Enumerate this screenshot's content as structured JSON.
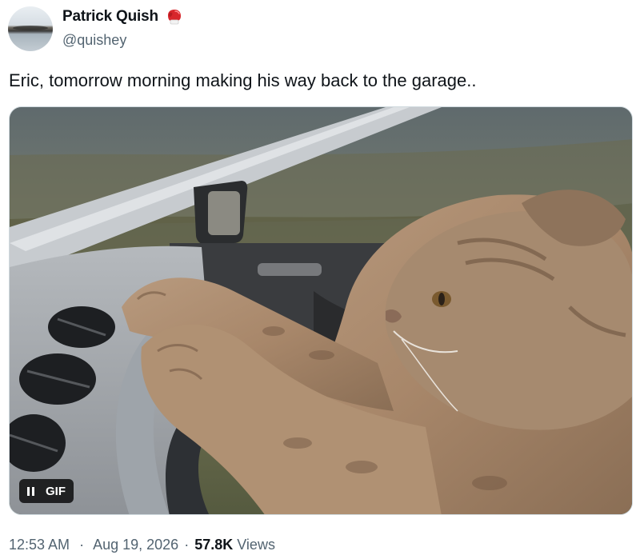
{
  "author": {
    "display_name": "Patrick Quish",
    "handle": "@quishey",
    "badge_icon": "boxing-glove-icon"
  },
  "tweet": {
    "text": "Eric, tomorrow morning making his way back to the garage..",
    "media": {
      "type_label": "GIF",
      "control_icon": "pause-icon"
    },
    "meta": {
      "time": "12:53 AM",
      "date": "Aug 19, 2026",
      "separator": "·",
      "views_count": "57.8K",
      "views_label": "Views"
    }
  },
  "colors": {
    "text_primary": "#0f1419",
    "text_secondary": "#536471",
    "border": "#cfd9de"
  }
}
